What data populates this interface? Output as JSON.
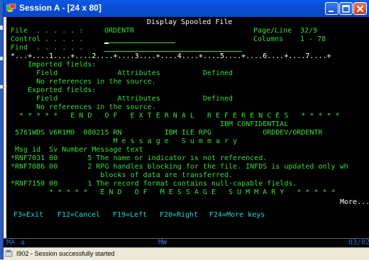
{
  "window": {
    "title": "Session A - [24 x 80]"
  },
  "screen": {
    "heading": "Display Spooled File",
    "file_label": "File  . . . . . :",
    "file_value": "ORDENTR",
    "control_label": "Control . . . . .",
    "control_value": "",
    "find_label": "Find  . . . . . .",
    "find_value": "",
    "page_line_label": "Page/Line",
    "page_line_value": "32/9",
    "columns_label": "Columns",
    "columns_value": "1 - 78",
    "ruler": "*...+....1....+....2....+....3....+....4....+....5....+....6....+....7....+",
    "lines": {
      "l1": "    Imported fields:",
      "l2": "      Field              Attributes          Defined",
      "l3": "      No references in the source.",
      "l4": "    Exported fields:",
      "l5": "      Field              Attributes          Defined",
      "l6": "      No references in the source.",
      "l7": "  * * * * *   E N D   O F   E X T E R N A L   R E F E R E N C E S   * * * * *",
      "l8": "                                                 IBM CONFIDENTIAL",
      "l9": " 5761WDS V6R1M0  080215 RN          IBM ILE RPG            ORDDEV/ORDENTR",
      "l10": "                        M e s s a g e   S u m m a r y",
      "l11": " Msg id  Sv Number Message text",
      "l12": "*RNF7031 00       5 The name or indicator is not referenced.",
      "l13": "*RNF7086 00       2 RPG handles blocking for the file. INFDS is updated only wh",
      "l14": "                     blocks of data are transferred.",
      "l15": "*RNF7150 00       1 The record format contains null-capable fields.",
      "l16": "         * * * * *   E N D   O F   M E S S A G E   S U M M A R Y   * * * * *",
      "more": "More..."
    },
    "fkeys": {
      "f3": "F3=Exit",
      "f12": "F12=Cancel",
      "f19": "F19=Left",
      "f20": "F20=Right",
      "f24": "F24=More keys"
    }
  },
  "oia": {
    "ma": "MA",
    "a": "a",
    "mw": "MW",
    "pos": "03/02"
  },
  "status": {
    "text": "I902 - Session successfully started"
  },
  "colors": {
    "green": "#3cdc3c",
    "white": "#ffffff",
    "turquoise": "#28d4d4",
    "blue": "#5a86ff",
    "yellow": "#ffff4a",
    "red": "#ff5a5a",
    "titlebar": "#0a58e6"
  },
  "icons": {
    "app": "session-a-icon",
    "minimize": "minimize-icon",
    "maximize": "maximize-icon",
    "close": "close-icon",
    "status": "status-icon"
  }
}
